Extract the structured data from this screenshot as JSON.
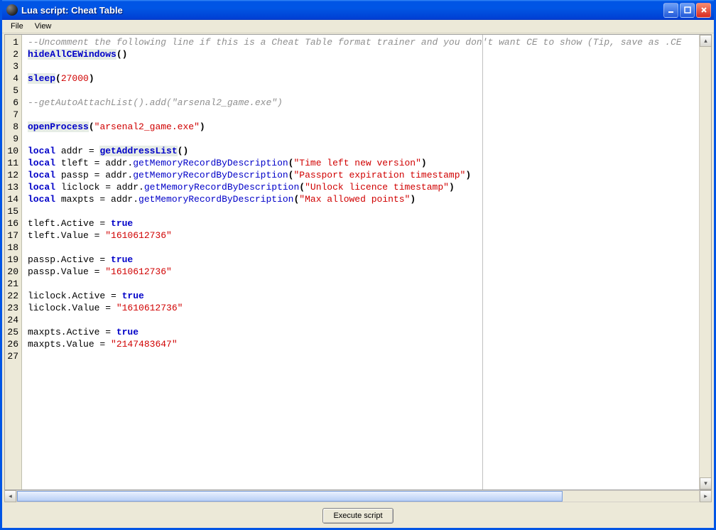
{
  "window": {
    "title": "Lua script: Cheat Table"
  },
  "menu": {
    "file": "File",
    "view": "View"
  },
  "button": {
    "execute": "Execute script"
  },
  "code": {
    "lines": [
      [
        {
          "t": "comment",
          "v": "--Uncomment the following line if this is a Cheat Table format trainer and you don't want CE to show (Tip, save as .CE"
        }
      ],
      [
        {
          "t": "funcbold",
          "v": "hideAllCEWindows"
        },
        {
          "t": "punct",
          "v": "()"
        }
      ],
      [],
      [
        {
          "t": "funcbold",
          "v": "sleep"
        },
        {
          "t": "punct",
          "v": "("
        },
        {
          "t": "num",
          "v": "27000"
        },
        {
          "t": "punct",
          "v": ")"
        }
      ],
      [],
      [
        {
          "t": "comment",
          "v": "--getAutoAttachList().add(\"arsenal2_game.exe\")"
        }
      ],
      [],
      [
        {
          "t": "funcbold",
          "v": "openProcess"
        },
        {
          "t": "punct",
          "v": "("
        },
        {
          "t": "string",
          "v": "\"arsenal2_game.exe\""
        },
        {
          "t": "punct",
          "v": ")"
        }
      ],
      [],
      [
        {
          "t": "keyword",
          "v": "local"
        },
        {
          "t": "plain",
          "v": " addr = "
        },
        {
          "t": "funcbold",
          "v": "getAddressList"
        },
        {
          "t": "punct",
          "v": "()"
        }
      ],
      [
        {
          "t": "keyword",
          "v": "local"
        },
        {
          "t": "plain",
          "v": " tleft = addr."
        },
        {
          "t": "func",
          "v": "getMemoryRecordByDescription"
        },
        {
          "t": "punct",
          "v": "("
        },
        {
          "t": "string",
          "v": "\"Time left new version\""
        },
        {
          "t": "punct",
          "v": ")"
        }
      ],
      [
        {
          "t": "keyword",
          "v": "local"
        },
        {
          "t": "plain",
          "v": " passp = addr."
        },
        {
          "t": "func",
          "v": "getMemoryRecordByDescription"
        },
        {
          "t": "punct",
          "v": "("
        },
        {
          "t": "string",
          "v": "\"Passport expiration timestamp\""
        },
        {
          "t": "punct",
          "v": ")"
        }
      ],
      [
        {
          "t": "keyword",
          "v": "local"
        },
        {
          "t": "plain",
          "v": " liclock = addr."
        },
        {
          "t": "func",
          "v": "getMemoryRecordByDescription"
        },
        {
          "t": "punct",
          "v": "("
        },
        {
          "t": "string",
          "v": "\"Unlock licence timestamp\""
        },
        {
          "t": "punct",
          "v": ")"
        }
      ],
      [
        {
          "t": "keyword",
          "v": "local"
        },
        {
          "t": "plain",
          "v": " maxpts = addr."
        },
        {
          "t": "func",
          "v": "getMemoryRecordByDescription"
        },
        {
          "t": "punct",
          "v": "("
        },
        {
          "t": "string",
          "v": "\"Max allowed points\""
        },
        {
          "t": "punct",
          "v": ")"
        }
      ],
      [],
      [
        {
          "t": "plain",
          "v": "tleft.Active = "
        },
        {
          "t": "keyword",
          "v": "true"
        }
      ],
      [
        {
          "t": "plain",
          "v": "tleft.Value = "
        },
        {
          "t": "string",
          "v": "\"1610612736\""
        }
      ],
      [],
      [
        {
          "t": "plain",
          "v": "passp.Active = "
        },
        {
          "t": "keyword",
          "v": "true"
        }
      ],
      [
        {
          "t": "plain",
          "v": "passp.Value = "
        },
        {
          "t": "string",
          "v": "\"1610612736\""
        }
      ],
      [],
      [
        {
          "t": "plain",
          "v": "liclock.Active = "
        },
        {
          "t": "keyword",
          "v": "true"
        }
      ],
      [
        {
          "t": "plain",
          "v": "liclock.Value = "
        },
        {
          "t": "string",
          "v": "\"1610612736\""
        }
      ],
      [],
      [
        {
          "t": "plain",
          "v": "maxpts.Active = "
        },
        {
          "t": "keyword",
          "v": "true"
        }
      ],
      [
        {
          "t": "plain",
          "v": "maxpts.Value = "
        },
        {
          "t": "string",
          "v": "\"2147483647\""
        }
      ],
      []
    ]
  }
}
